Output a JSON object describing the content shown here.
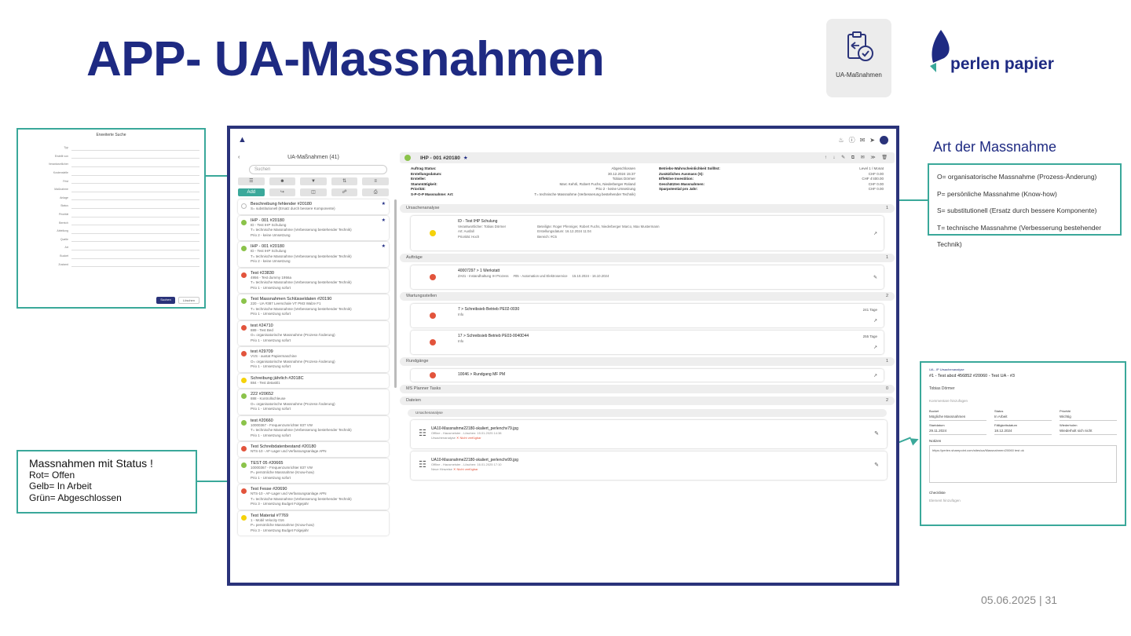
{
  "slide": {
    "title": "APP- UA-Massnahmen",
    "footer": "05.06.2025 | 31",
    "app_tile_label": "UA-Maßnahmen",
    "brand": "perlen papier"
  },
  "colors": {
    "title_blue": "#1e2a82",
    "teal": "#3aa89a",
    "frame_navy": "#2a337a",
    "status_red": "#e2543c",
    "status_yellow": "#f5d20a",
    "status_green": "#8bc34a"
  },
  "form_callout": {
    "title": "Erweiterte Suche",
    "rows": [
      "Typ",
      "Erstellt von",
      "Verantwortlicher",
      "Kostenstelle",
      "Frist",
      "Maßnahme",
      "Anlage",
      "Status",
      "Priorität",
      "Bereich",
      "Abteilung",
      "Quelle",
      "Art",
      "Bucket",
      "Zustand"
    ],
    "btn_search": "Suchen",
    "btn_reset": "Löschen"
  },
  "status_callout": {
    "title": "Massnahmen mit Status !",
    "lines": [
      "Rot= Offen",
      "Gelb= In Arbeit",
      "Grün= Abgeschlossen"
    ]
  },
  "art": {
    "title": "Art der Massnahme",
    "rows": [
      "O= organisatorische Massnahme (Prozess-Änderung)",
      "P= persönliche Massnahme (Know-how)",
      "S= substitutionell (Ersatz durch bessere Komponente)",
      "T= technische Massnahme (Verbesserung bestehender Technik)"
    ]
  },
  "app": {
    "left": {
      "header": "UA-Maßnahmen (41)",
      "search_placeholder": "Suchen",
      "btn_add": "Add",
      "cards": [
        {
          "status": "none",
          "title": "Beschreibung fehlender #20180",
          "lines": [
            "S= substitutionell (Ersatz durch bessere Komponente)"
          ],
          "star": true
        },
        {
          "status": "green",
          "title": "IHP - 001 #20180",
          "lines": [
            "ID - Test IHP Schulung",
            "T= technische Massnahme (Verbesserung bestehender Technik)",
            "Prio 2 - keine Umsetzung"
          ],
          "star": true
        },
        {
          "status": "green",
          "title": "IHP - 001 #20180",
          "lines": [
            "ID - Test IHP Schulung",
            "T= technische Massnahme (Verbesserung bestehender Technik)",
            "Prio 2 - keine Umsetzung"
          ],
          "star": true
        },
        {
          "status": "red",
          "title": "Test #23830",
          "lines": [
            "4956 - Test dummy 1956a",
            "T= technische Massnahme (Verbesserung bestehender Technik)",
            "Prio 1 - Umsetzung sofort"
          ],
          "star": false
        },
        {
          "status": "green",
          "title": "Test Massnahmen Schlüsseldaten #20190",
          "lines": [
            "220 - UA #387 Leerschale VT PM3 Walze F1",
            "T= technische Massnahme (Verbesserung bestehender Technik)",
            "Prio 1 - Umsetzung sofort"
          ],
          "star": false
        },
        {
          "status": "red",
          "title": "test #24710",
          "lines": [
            "889 - Test Bed",
            "O= organisatorische Massnahme (Prozess-Änderung)",
            "Prio 1 - Umsetzung sofort"
          ],
          "star": false
        },
        {
          "status": "red",
          "title": "test #29709",
          "lines": [
            "VVS - austat Papiermaschine",
            "O= organisatorische Massnahme (Prozess-Änderung)",
            "Prio 1 - Umsetzung sofort"
          ],
          "star": false
        },
        {
          "status": "yellow",
          "title": "Schreibung jährlich #2018C",
          "lines": [
            "884 - Test detaskl1"
          ],
          "star": false
        },
        {
          "status": "green",
          "title": "222 #20652",
          "lines": [
            "888 - Kontrollschleuse",
            "O= organisatorische Massnahme (Prozess-Änderung)",
            "Prio 1 - Umsetzung sofort"
          ],
          "star": false
        },
        {
          "status": "green",
          "title": "test #20660",
          "lines": [
            "10000367 - Frequenzumrichter 837 VW",
            "T= technische Massnahme (Verbesserung bestehender Technik)",
            "Prio 1 - Umsetzung sofort"
          ],
          "star": false
        },
        {
          "status": "red",
          "title": "Test Schreibdatenbestand #20180",
          "lines": [
            "NTS-10 - AF-Lager und Verfassungsanlage APN"
          ],
          "star": false
        },
        {
          "status": "green",
          "title": "TEST 05 #20665",
          "lines": [
            "10000367 - Frequenzumrichter 837 VW",
            "P= persönliche Massnahme (Know-how)",
            "Prio 1 - Umsetzung sofort"
          ],
          "star": false
        },
        {
          "status": "red",
          "title": "Test Fesse #20690",
          "lines": [
            "NTS-10 - AF-Lager und Verfassungsanlage APN",
            "T= technische Massnahme (Verbesserung bestehender Technik)",
            "Prio 3 - Umsetzung Budget Folgejahr"
          ],
          "star": false
        },
        {
          "status": "yellow",
          "title": "Test Material #7769",
          "lines": [
            "1 - Mobil Velocity 016",
            "P= persönliche Massnahme (Know-how)",
            "Prio 3 - Umsetzung Budget Folgejahr"
          ],
          "star": false
        }
      ]
    },
    "detail": {
      "title": "IHP - 001 #20180",
      "meta_left": [
        [
          "Auftrag Status:",
          "Abgeschlossen"
        ],
        [
          "Erstellungsdatum:",
          "30.12.2024 15:37"
        ],
        [
          "Ersteller:",
          "Tobias Dörmer"
        ],
        [
          "Stammtätigkeit:",
          "Marc Kehrli, Robert Fuchs, Niederberger Roland"
        ],
        [
          "Priorität:",
          "Prio 2 - keine Umsetzung"
        ],
        [
          "S-P-O-P Massnahme: Art:",
          "T= technische Massnahme (Verbesserung bestehender Technik)"
        ]
      ],
      "meta_right": [
        [
          "Betriebs-Wahrscheinlichkeit Soll/Ist:",
          "Level 1 / Monat"
        ],
        [
          "Zusätzliches Ausmass (S):",
          "CHF 0.00"
        ],
        [
          "Effektive Investition:",
          "CHF 4'400.00"
        ],
        [
          "Geschätzten Massnahmen:",
          "CHF 0.00"
        ],
        [
          "Sparpotential pro Jahr:",
          "CHF 0.00"
        ]
      ],
      "sections": {
        "ursachen": {
          "label": "Ursachenanalyse",
          "count": "1"
        },
        "auftraege": {
          "label": "Aufträge",
          "count": "1"
        },
        "wartung": {
          "label": "Wartungsstellen",
          "count": "2"
        },
        "rundgang": {
          "label": "Rundgänge",
          "count": "1"
        },
        "planner": {
          "label": "MS Planner Tasks",
          "count": "0"
        },
        "dateien": {
          "label": "Dateien",
          "count": "2"
        }
      },
      "ursache_card": {
        "line1": "ID - Test IHP Schulung",
        "line2": "Verantwortlicher: Tobias Dörmer",
        "line3": "Art: Ausfall",
        "line4": "Priorität: Hoch",
        "right1": "Beteiligte: Roger Pfenniger, Robert Fuchs, Niederberger Marco, Max Mustermann",
        "right2": "Erstellungsdatum: 16.12.2024 11:04",
        "right3": "Bereich: #C5"
      },
      "auftrag_card": {
        "line1": "40007297 > 1 Werkstatt",
        "line2": "ZA01 - Instandhaltung IH Prozess",
        "line3": "#05 - Automation und Elektroservice",
        "line4": "15.10.2024 - 16.10.2024"
      },
      "wartung_cards": [
        {
          "line1": "7 > Schreibsieb Betrieb PE02-0030",
          "line2": "Info",
          "days": "241 Tage"
        },
        {
          "line1": "17 > Schreibsieb Betrieb PE03-0040D44",
          "line2": "Info",
          "days": "255 Tage"
        }
      ],
      "rundgang_card": {
        "line1": "10046 > Rundgang MF PM"
      },
      "dateien_sub": "Ursachenanalyse",
      "files": [
        {
          "name": "UA10-Massnahme22180-skaliert_perlenchv79.jpg",
          "meta": "Offline - Hausmeister - Löschen: 15.01.2025 14:38",
          "sub": "Ursachenanalyse",
          "warn": "Nicht verfügbar"
        },
        {
          "name": "UA10-Massnahme22180-skaliert_perlenchv99.jpg",
          "meta": "Offline - Hausmeister - Löschen: 16.01.2025 17:10",
          "sub": "Neue Hinweise",
          "warn": "Nicht verfügbar"
        }
      ]
    }
  },
  "task_dialog": {
    "crumb": "UA - IP Ursachenanalyse",
    "title": "#1 - Test abcd 456852 #20060 - Test UA - #3",
    "owner": "Tobias Dörmer",
    "comment": "Kommentare hinzufügen",
    "fields": [
      {
        "label": "Bucket",
        "value": "Mögliche Massnahmen"
      },
      {
        "label": "Status",
        "value": "In Arbeit"
      },
      {
        "label": "Priorität",
        "value": "Wichtig"
      },
      {
        "label": "Startdatum",
        "value": "29.11.2024"
      },
      {
        "label": "Fälligkeitsdatum",
        "value": "18.12.2024"
      },
      {
        "label": "Wiederholen",
        "value": "Wiederholt sich nicht"
      }
    ],
    "notes_label": "Notizen",
    "notes_text": "https://perlen.sharepoint.com/sites/ua/Massnahmen/20060 test ok",
    "checklist": "Checkliste",
    "checklist_add": "Element hinzufügen"
  }
}
